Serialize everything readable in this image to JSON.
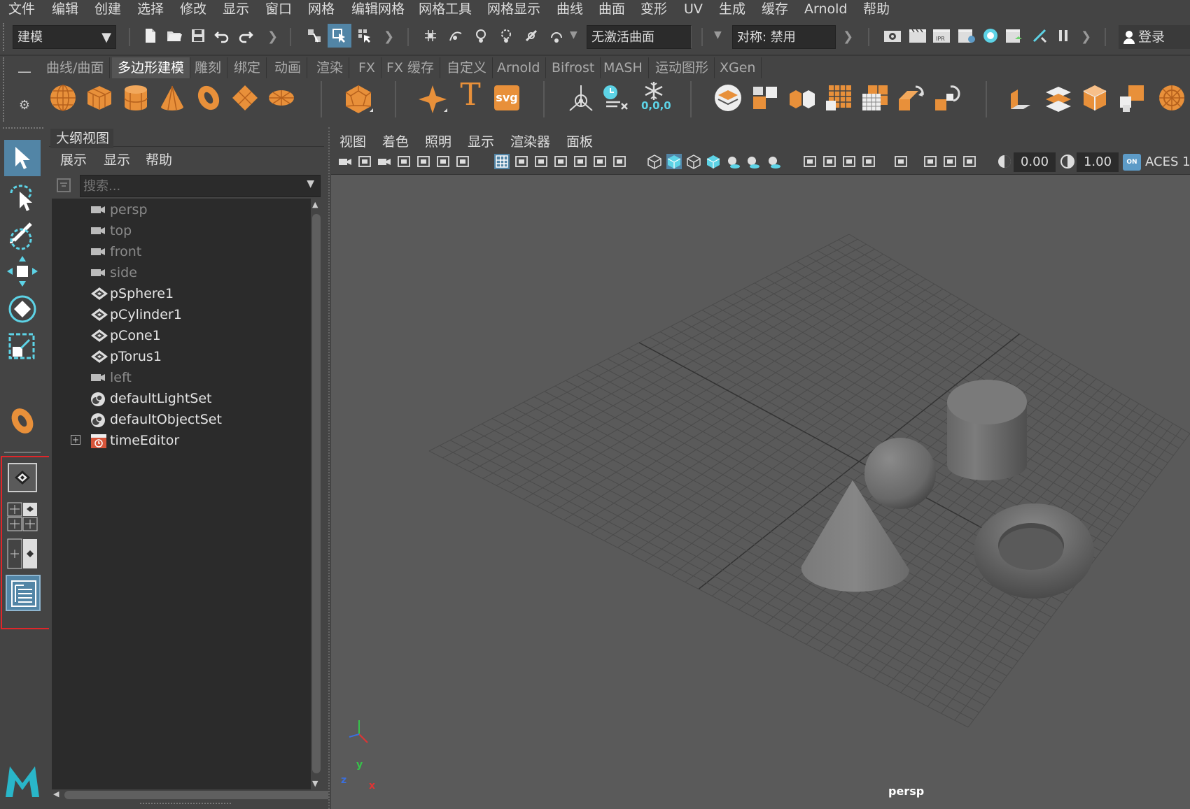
{
  "menubar": [
    "文件",
    "编辑",
    "创建",
    "选择",
    "修改",
    "显示",
    "窗口",
    "网格",
    "编辑网格",
    "网格工具",
    "网格显示",
    "曲线",
    "曲面",
    "变形",
    "UV",
    "生成",
    "缓存",
    "Arnold",
    "帮助"
  ],
  "toolbar": {
    "mode_select": "建模",
    "live_surface": "无激活曲面",
    "symmetry": "对称: 禁用",
    "login": "登录"
  },
  "shelf_tabs": [
    "曲线/曲面",
    "多边形建模",
    "雕刻",
    "绑定",
    "动画",
    "渲染",
    "FX",
    "FX 缓存",
    "自定义",
    "Arnold",
    "Bifrost",
    "MASH",
    "运动图形",
    "XGen"
  ],
  "shelf_active_tab": "多边形建模",
  "shelf_icons": [
    "sphere-icon",
    "cube-icon",
    "cylinder-icon",
    "cone-icon",
    "torus-icon",
    "plane-icon",
    "disc-icon",
    "platonic-icon",
    "type-icon",
    "text-icon",
    "svg-icon",
    "pivot-icon",
    "time-icon",
    "snowflake-icon",
    "combine-icon",
    "separate-icon",
    "extract-icon",
    "smooth-icon",
    "multicut-icon",
    "bevel-icon",
    "bridge-icon",
    "extrude-icon",
    "append-icon",
    "fill-hole-icon",
    "mirror-icon"
  ],
  "shelf_labels": {
    "text_tool": "T",
    "svg_tool": "svg",
    "snow_value": "0,0,0"
  },
  "outliner": {
    "title": "大纲视图",
    "menu": [
      "展示",
      "显示",
      "帮助"
    ],
    "search_placeholder": "搜索...",
    "items": [
      {
        "label": "persp",
        "type": "camera",
        "dim": true
      },
      {
        "label": "top",
        "type": "camera",
        "dim": true
      },
      {
        "label": "front",
        "type": "camera",
        "dim": true
      },
      {
        "label": "side",
        "type": "camera",
        "dim": true
      },
      {
        "label": "pSphere1",
        "type": "mesh",
        "dim": false
      },
      {
        "label": "pCylinder1",
        "type": "mesh",
        "dim": false
      },
      {
        "label": "pCone1",
        "type": "mesh",
        "dim": false
      },
      {
        "label": "pTorus1",
        "type": "mesh",
        "dim": false
      },
      {
        "label": "left",
        "type": "camera",
        "dim": true
      },
      {
        "label": "defaultLightSet",
        "type": "set",
        "dim": false
      },
      {
        "label": "defaultObjectSet",
        "type": "set",
        "dim": false
      },
      {
        "label": "timeEditor",
        "type": "time",
        "dim": false
      }
    ]
  },
  "viewport": {
    "menu": [
      "视图",
      "着色",
      "照明",
      "显示",
      "渲染器",
      "面板"
    ],
    "exposure": "0.00",
    "gamma": "1.00",
    "colorspace": "ACES 1.",
    "camera_label": "persp",
    "on_badge": "ON",
    "axis": {
      "x": "x",
      "y": "y",
      "z": "z"
    }
  },
  "logo": "M",
  "colors": {
    "accent_orange": "#e8903a",
    "accent_blue": "#5d9bc7",
    "highlight_red": "#e0262a",
    "selected_bg": "#5285a6"
  }
}
